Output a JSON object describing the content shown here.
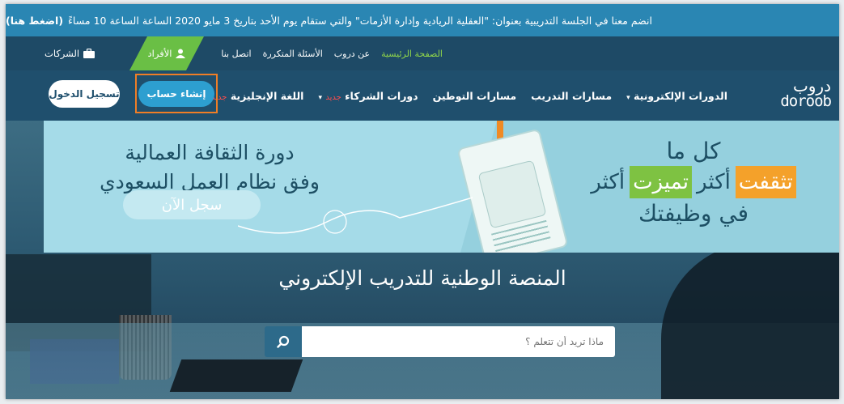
{
  "announcement": {
    "text": "انضم معنا في الجلسة التدريبية بعنوان: \"العقلية الريادية وإدارة الأزمات\" والتي ستقام يوم الأحد بتاريخ 3 مايو 2020 الساعة الساعة 10 مساءً",
    "cta": "(اضغط هنا)"
  },
  "topnav": {
    "links": [
      "الصفحة الرئيسية",
      "عن دروب",
      "الأسئلة المتكررة",
      "اتصل بنا"
    ],
    "individuals": "الأفراد",
    "companies": "الشركات"
  },
  "logo": {
    "arabic": "دروب",
    "latin": "doroob"
  },
  "mainnav": {
    "items": [
      {
        "label": "الدورات الإلكترونية",
        "caret": "▾",
        "tag": ""
      },
      {
        "label": "مسارات التدريب",
        "caret": "",
        "tag": ""
      },
      {
        "label": "مسارات التوطين",
        "caret": "",
        "tag": ""
      },
      {
        "label": "دورات الشركاء",
        "caret": "▾",
        "tag": "جديد"
      },
      {
        "label": "اللغة الإنجليزية",
        "caret": "",
        "tag": "جديد"
      }
    ],
    "create_account": "إنشاء حساب",
    "login": "تسجيل الدخول"
  },
  "banner": {
    "right_line1": "كل ما",
    "right_word1": "تثقفت",
    "right_word2": "أكثر",
    "right_word3": "تميزت",
    "right_word4": "أكثر",
    "right_line3": "في وظيفتك",
    "left_line1": "دورة الثقافة العمالية",
    "left_line2": "وفق نظام العمل السعودي",
    "register": "سجل الآن"
  },
  "hero": {
    "title": "المنصة الوطنية للتدريب الإلكتروني",
    "search_placeholder": "ماذا تريد أن تتعلم ؟"
  },
  "colors": {
    "announce_bg": "#2a86b3",
    "nav_bg": "#1f4f6d",
    "green": "#6abf45",
    "orange_outline": "#f07e26"
  }
}
